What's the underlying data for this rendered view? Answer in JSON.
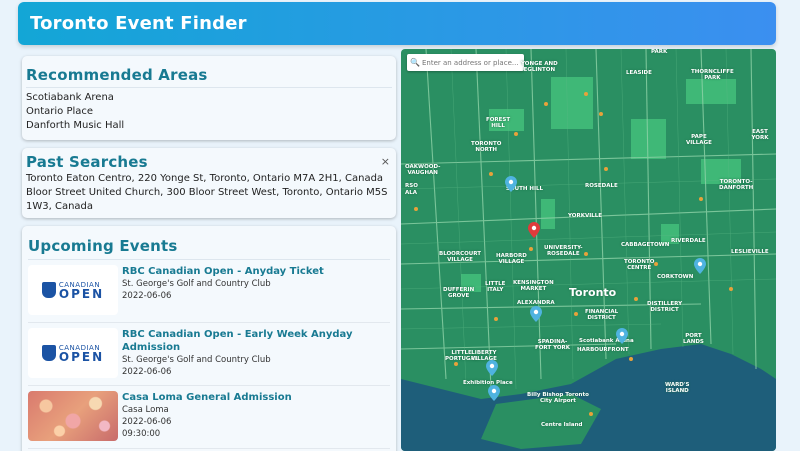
{
  "app": {
    "title": "Toronto Event Finder"
  },
  "recommended": {
    "heading": "Recommended Areas",
    "items": [
      "Scotiabank Arena",
      "Ontario Place",
      "Danforth Music Hall"
    ]
  },
  "past_searches": {
    "heading": "Past Searches",
    "close_glyph": "×",
    "items": [
      "Toronto Eaton Centro, 220 Yonge St, Toronto, Ontario M7A 2H1, Canada",
      "Bloor Street United Church, 300 Bloor Street West, Toronto, Ontario M5S 1W3, Canada"
    ]
  },
  "upcoming": {
    "heading": "Upcoming Events",
    "events": [
      {
        "title": "RBC Canadian Open - Anyday Ticket",
        "venue": "St. George's Golf and Country Club",
        "date": "2022-06-06",
        "time": "",
        "thumb": "rbc",
        "logo_top": "CANADIAN",
        "logo_bottom": "OPEN"
      },
      {
        "title": "RBC Canadian Open - Early Week Anyday Admission",
        "venue": "St. George's Golf and Country Club",
        "date": "2022-06-06",
        "time": "",
        "thumb": "rbc",
        "logo_top": "CANADIAN",
        "logo_bottom": "OPEN"
      },
      {
        "title": "Casa Loma General Admission",
        "venue": "Casa Loma",
        "date": "2022-06-06",
        "time": "09:30:00",
        "thumb": "bokeh"
      }
    ]
  },
  "map": {
    "search_placeholder": "Enter an address or place...",
    "city_label": "Toronto",
    "labels": {
      "yonge_eglinton": "YONGE AND\nEGLINTON",
      "leaside": "LEASIDE",
      "thorncliffe": "THORNCLIFFE\nPARK",
      "forest_hill": "FOREST\nHILL",
      "toronto_north": "TORONTO\nNORTH",
      "pape_village": "PAPE\nVILLAGE",
      "east_york": "EAST YORK",
      "oakwood": "OAKWOOD-\nVAUGHAN",
      "south_hill": "SOUTH HILL",
      "rosedale": "ROSEDALE",
      "toronto_danforth": "TORONTO-\nDANFORTH",
      "yorkville": "YORKVILLE",
      "university_rosedale": "UNIVERSITY-\nROSEDALE",
      "cabbagetown": "CABBAGETOWN",
      "riverdale": "RIVERDALE",
      "leslieville": "LESLIEVILLE",
      "bloorcourt": "BLOORCOURT\nVILLAGE",
      "harbord": "HARBORD\nVILLAGE",
      "toronto_centre": "TORONTO\nCENTRE",
      "corktown": "CORKTOWN",
      "dufferin_grove": "DUFFERIN\nGROVE",
      "little_italy": "LITTLE\nITALY",
      "kensington": "KENSINGTON\nMARKET",
      "alexandra": "ALEXANDRA",
      "financial": "FINANCIAL\nDISTRICT",
      "distillery": "DISTILLERY\nDISTRICT",
      "spadina": "SPADINA-\nFORT YORK",
      "harbourfront": "HARBOURFRONT",
      "port_lands": "PORT\nLANDS",
      "little_portugal": "LITTLE\nPORTUGAL",
      "liberty": "LIBERTY\nVILLAGE",
      "wards_island": "WARD'S\nISLAND",
      "exhibition": "Exhibition Place",
      "scotiabank": "Scotiabank Arena",
      "billy_bishop": "Billy Bishop Toronto\nCity Airport",
      "centre_island": "Centre Island",
      "park": "PARK",
      "rso": "RSO",
      "ala": "ALA"
    },
    "colors": {
      "land": "#2a8f62",
      "park": "#3fb877",
      "water": "#1e5e7a",
      "pin_blue": "#4fb3e0",
      "pin_red": "#e03b3b"
    }
  }
}
